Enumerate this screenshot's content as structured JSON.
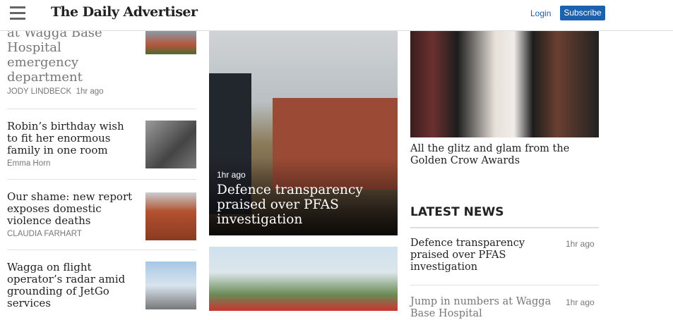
{
  "header": {
    "logo": "The Daily Advertiser",
    "login": "Login",
    "subscribe": "Subscribe"
  },
  "left_articles": [
    {
      "title": "at Wagga Base Hospital emergency department",
      "author": "JODY LINDBECK",
      "time": "1hr ago"
    },
    {
      "title": "Robin’s birthday wish to fit her enormous family in one room",
      "author": "Emma Horn"
    },
    {
      "title": "Our shame: new report exposes domestic violence deaths",
      "author": "CLAUDIA FARHART"
    },
    {
      "title": "Wagga on flight operator’s radar amid grounding of JetGo services"
    }
  ],
  "feature": {
    "time": "1hr ago",
    "title": "Defence transparency praised over PFAS investigation"
  },
  "glitz": {
    "title": "All the glitz and glam from the Golden Crow Awards"
  },
  "latest": {
    "heading": "LATEST NEWS",
    "items": [
      {
        "title": "Defence transparency praised over PFAS investigation",
        "time": "1hr ago"
      },
      {
        "title": "Jump in numbers at Wagga Base Hospital",
        "time": "1hr ago"
      }
    ]
  }
}
